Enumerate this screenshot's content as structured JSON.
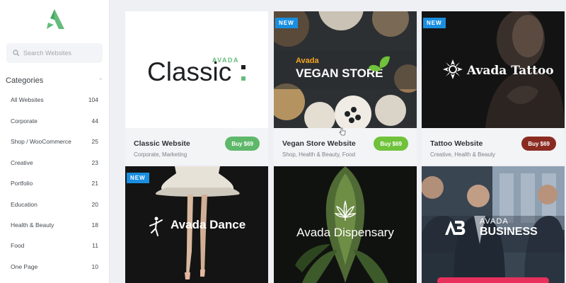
{
  "colors": {
    "brand_green": "#65bc7b",
    "buy_green": "#5fb86a",
    "buy_bright": "#6fc23a",
    "buy_maroon": "#8a2b22",
    "new_badge": "#1a8ee0"
  },
  "sidebar": {
    "logo_icon": "avada-logo-icon",
    "search_placeholder": "Search Websites",
    "categories_title": "Categories",
    "categories": [
      {
        "label": "All Websites",
        "count": "104"
      },
      {
        "label": "Corporate",
        "count": "44"
      },
      {
        "label": "Shop / WooCommerce",
        "count": "25"
      },
      {
        "label": "Creative",
        "count": "23"
      },
      {
        "label": "Portfolio",
        "count": "21"
      },
      {
        "label": "Education",
        "count": "20"
      },
      {
        "label": "Health & Beauty",
        "count": "18"
      },
      {
        "label": "Food",
        "count": "11"
      },
      {
        "label": "One Page",
        "count": "10"
      }
    ]
  },
  "cards": [
    {
      "name": "Classic Website",
      "tags": "Corporate, Marketing",
      "buy": "Buy $69",
      "badge": "",
      "thumb": {
        "top": "AVADA",
        "main": "Classic"
      }
    },
    {
      "name": "Vegan Store Website",
      "tags": "Shop, Health & Beauty, Food",
      "buy": "Buy $69",
      "badge": "NEW",
      "thumb": {
        "top": "Avada",
        "main": "VEGAN STORE"
      }
    },
    {
      "name": "Tattoo Website",
      "tags": "Creative, Health & Beauty",
      "buy": "Buy $69",
      "badge": "NEW",
      "thumb": {
        "main": "Avada Tattoo"
      }
    },
    {
      "name": "",
      "tags": "",
      "buy": "",
      "badge": "NEW",
      "thumb": {
        "main": "Avada Dance"
      }
    },
    {
      "name": "",
      "tags": "",
      "buy": "",
      "badge": "",
      "thumb": {
        "main": "Avada Dispensary"
      }
    },
    {
      "name": "",
      "tags": "",
      "buy": "",
      "badge": "",
      "thumb": {
        "top": "AVADA",
        "main": "BUSINESS"
      }
    }
  ]
}
